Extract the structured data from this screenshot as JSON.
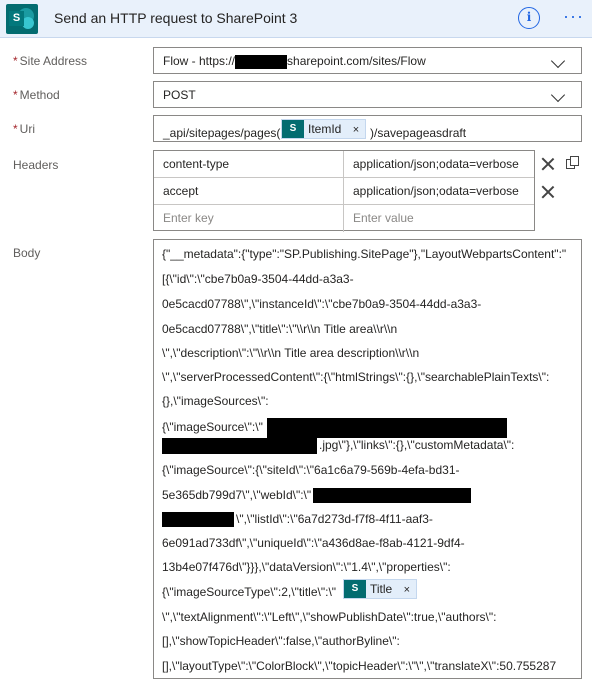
{
  "header": {
    "title": "Send an HTTP request to SharePoint 3",
    "logo_letter": "S",
    "info_glyph": "i",
    "more_glyph": "···",
    "icons": [
      "sharepoint-logo-icon",
      "info-icon",
      "more-icon"
    ]
  },
  "fields": {
    "site_address": {
      "label": "Site Address",
      "required_mark": "*",
      "value_prefix": "Flow - https://",
      "value_suffix": "sharepoint.com/sites/Flow"
    },
    "method": {
      "label": "Method",
      "required_mark": "*",
      "value": "POST"
    },
    "uri": {
      "label": "Uri",
      "required_mark": "*",
      "text_before": "_api/sitepages/pages(",
      "token_label": "ItemId",
      "token_close": "×",
      "text_after": ")/savepageasdraft"
    },
    "headers": {
      "label": "Headers",
      "rows": [
        {
          "key": "content-type",
          "value": "application/json;odata=verbose"
        },
        {
          "key": "accept",
          "value": "application/json;odata=verbose"
        }
      ],
      "key_placeholder": "Enter key",
      "value_placeholder": "Enter value"
    },
    "body": {
      "label": "Body",
      "token_label": "Title",
      "token_close": "×",
      "lines": [
        "{\"__metadata\":{\"type\":\"SP.Publishing.SitePage\"},\"LayoutWebpartsContent\":\"",
        "[{\\\"id\\\":\\\"cbe7b0a9-3504-44dd-a3a3-",
        "0e5cacd07788\\\",\\\"instanceId\\\":\\\"cbe7b0a9-3504-44dd-a3a3-",
        "0e5cacd07788\\\",\\\"title\\\":\\\"\\\\r\\\\n       Title area\\\\r\\\\n",
        "\\\",\\\"description\\\":\\\"\\\\r\\\\n       Title area description\\\\r\\\\n",
        "\\\",\\\"serverProcessedContent\\\":{\\\"htmlStrings\\\":{},\\\"searchablePlainTexts\\\":",
        "{},\\\"imageSources\\\":",
        "{\\\"imageSource\\\":\\\"",
        ".jpg\\\"},\\\"links\\\":{},\\\"customMetadata\\\":",
        "{\\\"imageSource\\\":{\\\"siteId\\\":\\\"6a1c6a79-569b-4efa-bd31-",
        "5e365db799d7\\\",\\\"webId\\\":\\\"",
        "\\\",\\\"listId\\\":\\\"6a7d273d-f7f8-4f11-aaf3-",
        "6e091ad733df\\\",\\\"uniqueId\\\":\\\"a436d8ae-f8ab-4121-9df4-",
        "13b4e07f476d\\\"}}},\\\"dataVersion\\\":\\\"1.4\\\",\\\"properties\\\":",
        "{\\\"imageSourceType\\\":2,\\\"title\\\":\\\"",
        "\\\",\\\"textAlignment\\\":\\\"Left\\\",\\\"showPublishDate\\\":true,\\\"authors\\\":",
        "[],\\\"showTopicHeader\\\":false,\\\"authorByline\\\":",
        "[],\\\"layoutType\\\":\\\"ColorBlock\\\",\\\"topicHeader\\\":\\\"\\\",\\\"translateX\\\":50.755287"
      ]
    }
  },
  "token_icon_letter": "S",
  "colors": {
    "header_bg": "#e9f1fb",
    "accent": "#2266e3",
    "required": "#a4262c",
    "token_bg": "#e3eefa",
    "sharepoint": "#036c70"
  }
}
